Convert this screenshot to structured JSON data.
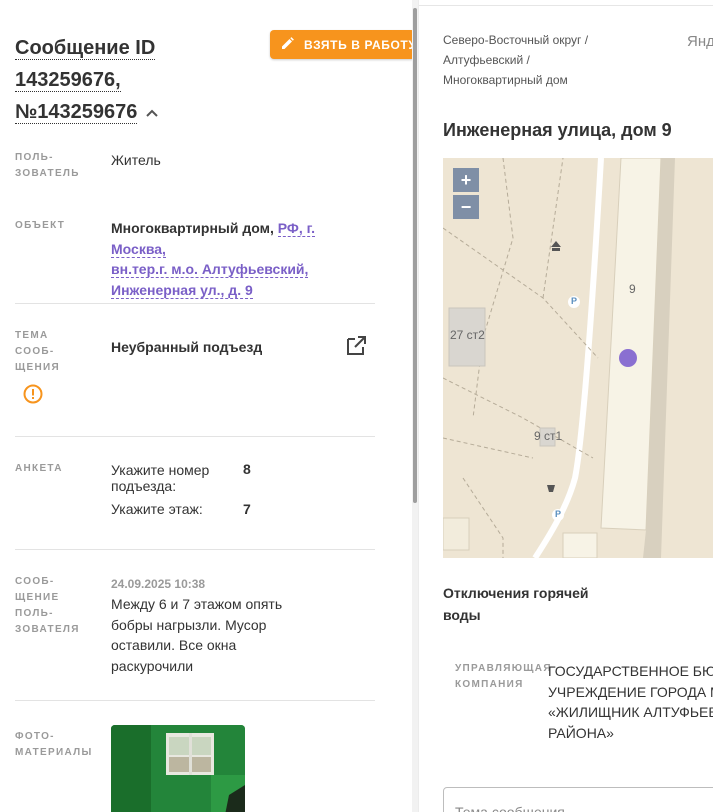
{
  "header": {
    "title_line1": "Сообщение ID",
    "title_line2": "143259676,",
    "title_line3": "№143259676",
    "take_button": "ВЗЯТЬ В РАБОТУ"
  },
  "fields": {
    "user_label_1": "ПОЛЬ-",
    "user_label_2": "ЗОВАТЕЛЬ",
    "user_value": "Житель",
    "object_label": "ОБЪЕКТ",
    "object_type": "Многоквартирный дом,",
    "object_link_1": "РФ, г. Москва,",
    "object_link_2": "вн.тер.г. м.о. Алтуфьевский,",
    "object_link_3": "Инженерная ул., д. 9",
    "topic_label_1": "ТЕМА",
    "topic_label_2": "СООБ-",
    "topic_label_3": "ЩЕНИЯ",
    "topic_value": "Неубранный подъезд",
    "survey_label": "АНКЕТА",
    "survey_q1": "Укажите номер подъезда:",
    "survey_a1": "8",
    "survey_q2": "Укажите этаж:",
    "survey_a2": "7",
    "msg_label_1": "СООБ-",
    "msg_label_2": "ЩЕНИЕ",
    "msg_label_3": "ПОЛЬ-",
    "msg_label_4": "ЗОВАТЕЛЯ",
    "msg_date": "24.09.2025 10:38",
    "msg_text": "Между 6 и 7 этажом опять бобры нагрызли. Мусор оставили. Все окна раскурочили",
    "photo_label_1": "ФОТО-",
    "photo_label_2": "МАТЕРИАЛЫ"
  },
  "right": {
    "crumb_1": "Северо-Восточный округ /",
    "crumb_2": "Алтуфьевский /",
    "crumb_3": "Многоквартирный дом",
    "yandex": "Янд",
    "address": "Инженерная улица, дом 9",
    "map": {
      "zoom_in": "+",
      "zoom_out": "−",
      "label_9": "9",
      "label_27": "27 ст2",
      "label_9st1": "9 ст1",
      "parking": "P"
    },
    "outage": "Отключения горячей воды",
    "mc_label_1": "УПРАВЛЯЮЩАЯ",
    "mc_label_2": "КОМПАНИЯ",
    "mc_line_1": "ГОСУДАРСТВЕННОЕ БЮДЖ",
    "mc_line_2": "УЧРЕЖДЕНИЕ ГОРОДА МО",
    "mc_line_3": "«ЖИЛИЩНИК АЛТУФЬЕВС",
    "mc_line_4": "РАЙОНА»",
    "topic_placeholder": "Тема сообщения"
  },
  "colors": {
    "accent_orange": "#f7941d",
    "link_purple": "#7a5fc7",
    "marker_purple": "#8a6fd1"
  }
}
